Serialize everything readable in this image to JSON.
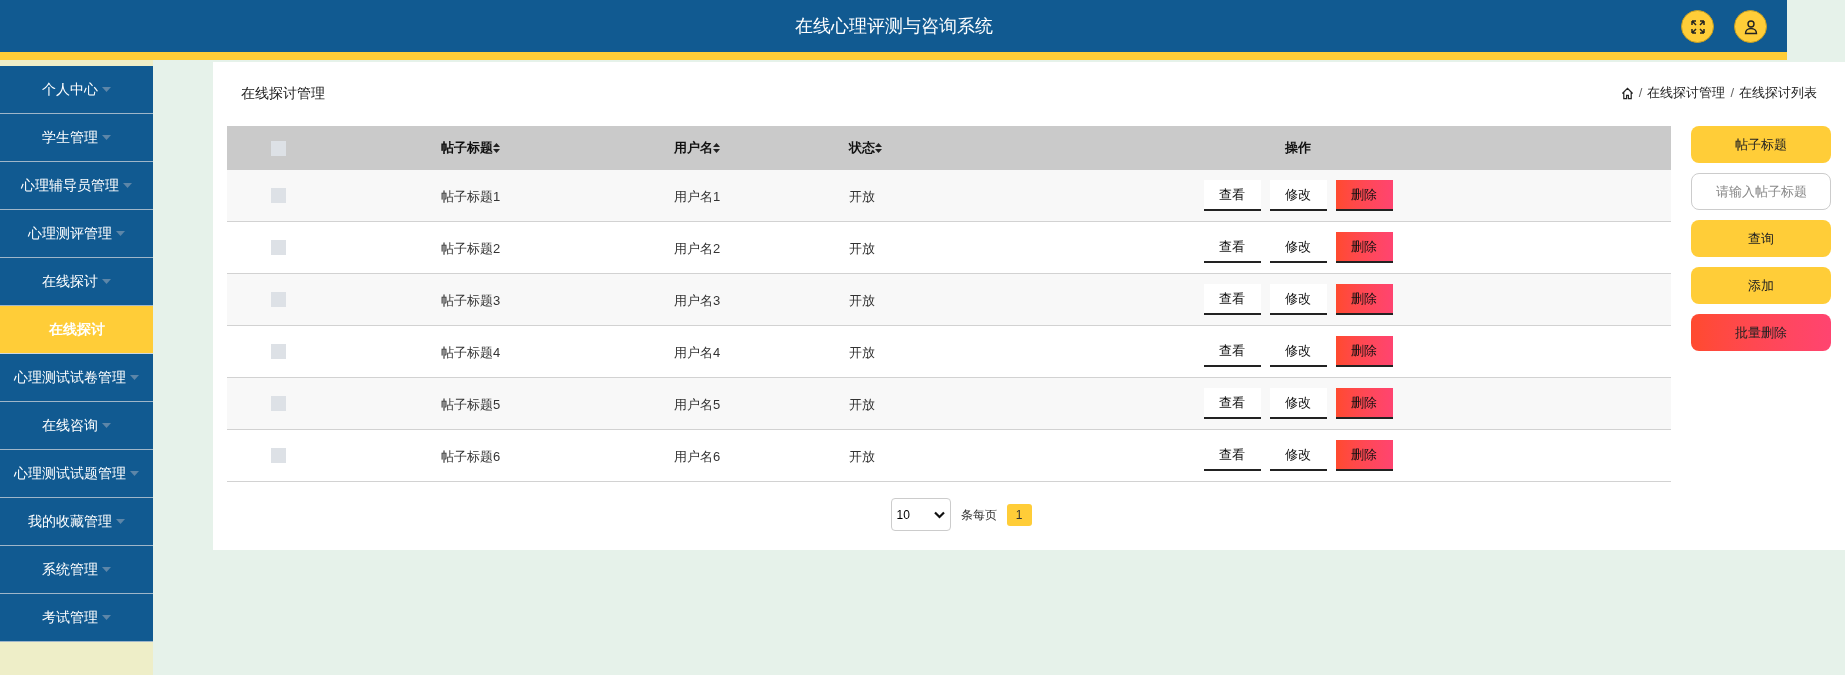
{
  "header": {
    "title": "在线心理评测与咨询系统"
  },
  "sidebar": {
    "items": [
      {
        "label": "个人中心",
        "kind": "menu",
        "selected": false
      },
      {
        "label": "学生管理",
        "kind": "menu",
        "selected": false
      },
      {
        "label": "心理辅导员管理",
        "kind": "menu",
        "selected": false
      },
      {
        "label": "心理测评管理",
        "kind": "menu",
        "selected": false
      },
      {
        "label": "在线探讨",
        "kind": "menu",
        "selected": false
      },
      {
        "label": "在线探讨",
        "kind": "submenu",
        "selected": true
      },
      {
        "label": "心理测试试卷管理",
        "kind": "menu",
        "selected": false
      },
      {
        "label": "在线咨询",
        "kind": "menu",
        "selected": false
      },
      {
        "label": "心理测试试题管理",
        "kind": "menu",
        "selected": false
      },
      {
        "label": "我的收藏管理",
        "kind": "menu",
        "selected": false
      },
      {
        "label": "系统管理",
        "kind": "menu",
        "selected": false
      },
      {
        "label": "考试管理",
        "kind": "menu",
        "selected": false
      }
    ]
  },
  "page_title": "在线探讨管理",
  "breadcrumb": {
    "separator": "/",
    "items": [
      "在线探讨管理",
      "在线探讨列表"
    ]
  },
  "table": {
    "select_all_checked": false,
    "columns": [
      "帖子标题",
      "用户名",
      "状态",
      "操作"
    ],
    "rows": [
      {
        "checked": false,
        "title": "帖子标题1",
        "username": "用户名1",
        "status": "开放",
        "actions": [
          "查看",
          "修改",
          "删除"
        ]
      },
      {
        "checked": false,
        "title": "帖子标题2",
        "username": "用户名2",
        "status": "开放",
        "actions": [
          "查看",
          "修改",
          "删除"
        ]
      },
      {
        "checked": false,
        "title": "帖子标题3",
        "username": "用户名3",
        "status": "开放",
        "actions": [
          "查看",
          "修改",
          "删除"
        ]
      },
      {
        "checked": false,
        "title": "帖子标题4",
        "username": "用户名4",
        "status": "开放",
        "actions": [
          "查看",
          "修改",
          "删除"
        ]
      },
      {
        "checked": false,
        "title": "帖子标题5",
        "username": "用户名5",
        "status": "开放",
        "actions": [
          "查看",
          "修改",
          "删除"
        ]
      },
      {
        "checked": false,
        "title": "帖子标题6",
        "username": "用户名6",
        "status": "开放",
        "actions": [
          "查看",
          "修改",
          "删除"
        ]
      }
    ]
  },
  "pagination": {
    "page_size": "10",
    "page_size_label": "条每页",
    "pages": [
      {
        "label": "1",
        "selected": true
      }
    ]
  },
  "search_panel": {
    "field_label": "帖子标题",
    "placeholder": "请输入帖子标题",
    "buttons": [
      {
        "label": "查询",
        "kind": "primary"
      },
      {
        "label": "添加",
        "kind": "primary"
      },
      {
        "label": "批量删除",
        "kind": "danger"
      }
    ]
  }
}
